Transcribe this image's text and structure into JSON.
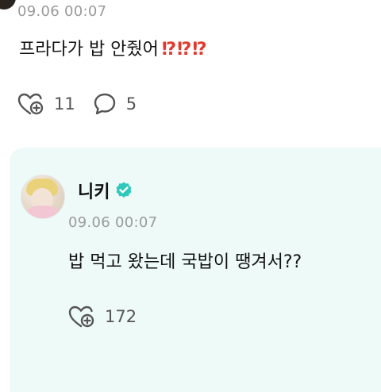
{
  "post": {
    "time": "09.06 00:07",
    "text": "프라다가 밥 안줬어",
    "emphasis": "⁉⁉⁉",
    "like_count": "11",
    "comment_count": "5"
  },
  "reply": {
    "name": "니키",
    "time": "09.06 00:07",
    "text": "밥 먹고 왔는데 국밥이 땡겨서??",
    "like_count": "172"
  },
  "colors": {
    "emphasis": "#e03a2e",
    "reply_background": "#eefaf8",
    "verified": "#2fc8bb"
  },
  "icons": {
    "like": "heart-with-plus-icon",
    "comment": "speech-bubble-icon",
    "verified": "verified-badge-icon"
  }
}
